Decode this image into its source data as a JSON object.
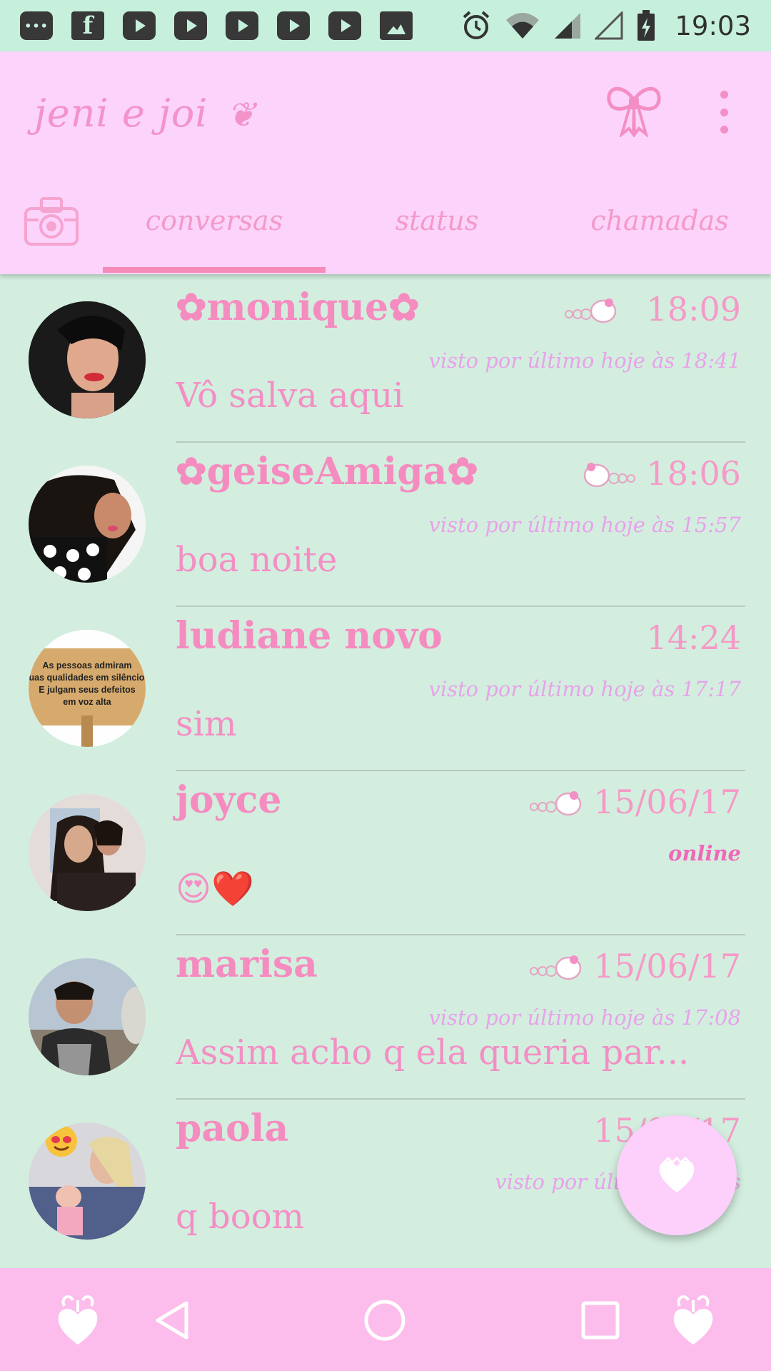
{
  "status_bar": {
    "time": "19:03",
    "notification_icons": [
      "more-icon",
      "facebook-icon",
      "youtube-icon",
      "youtube-icon",
      "youtube-icon",
      "youtube-icon",
      "youtube-icon",
      "image-icon"
    ],
    "system_icons": [
      "alarm-icon",
      "wifi-icon",
      "signal-icon",
      "signal-empty-icon",
      "battery-charging-icon"
    ]
  },
  "app_bar": {
    "title": "jeni e joi",
    "title_heart": "❦",
    "tabs": [
      {
        "label": "conversas",
        "selected": true
      },
      {
        "label": "status",
        "selected": false
      },
      {
        "label": "chamadas",
        "selected": false
      }
    ]
  },
  "chats": [
    {
      "name": "✿monique✿",
      "time": "18:09",
      "seen": "visto por último hoje às 18:41",
      "message": "Vô salva aqui",
      "kitty": true
    },
    {
      "name": "✿geiseAmiga✿",
      "time": "18:06",
      "seen": "visto por último hoje às 15:57",
      "message": "boa noite",
      "kitty": true
    },
    {
      "name": "ludiane novo",
      "time": "14:24",
      "seen": "visto por último hoje às 17:17",
      "message": "sim",
      "kitty": false,
      "avatar_text": [
        "As pessoas admiram",
        "suas qualidades em silêncio",
        "E julgam seus defeitos",
        "em voz alta"
      ]
    },
    {
      "name": "joyce",
      "time": "15/06/17",
      "seen": "online",
      "message": "😍❤️",
      "kitty": true
    },
    {
      "name": "marisa",
      "time": "15/06/17",
      "seen": "visto por último hoje às 17:08",
      "message": "Assim acho q ela queria par...",
      "kitty": true
    },
    {
      "name": "paola",
      "time": "15/06/17",
      "seen": "visto por último hoje às",
      "message": "q boom",
      "kitty": false
    }
  ],
  "colors": {
    "background": "#d3eedf",
    "app_bar": "#fbd3fb",
    "status_bar": "#c6f0dc",
    "accent": "#f58bb8",
    "nav_bar": "#fcbdec"
  }
}
